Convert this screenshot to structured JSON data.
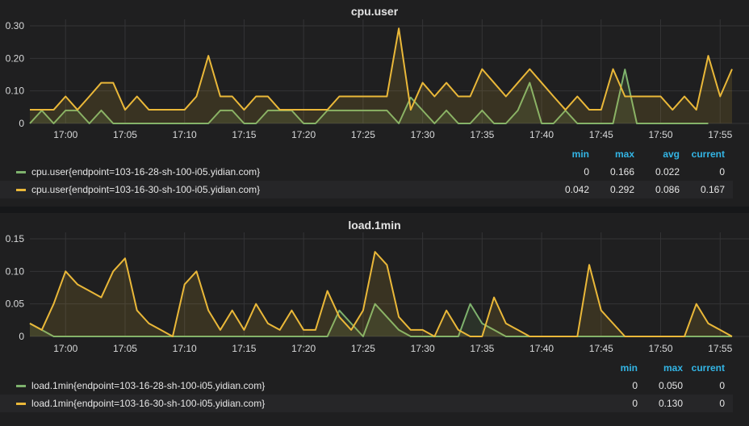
{
  "colors": {
    "green": "#7eb26d",
    "yellow": "#eab839",
    "grid": "#343436",
    "header": "#33b5e5"
  },
  "xticks": [
    "17:00",
    "17:05",
    "17:10",
    "17:15",
    "17:20",
    "17:25",
    "17:30",
    "17:35",
    "17:40",
    "17:45",
    "17:50",
    "17:55"
  ],
  "chart_data": [
    {
      "type": "line",
      "title": "cpu.user",
      "x_start_minute": "16:57",
      "x_step_minutes": 1,
      "yticks": [
        "0",
        "0.10",
        "0.20",
        "0.30"
      ],
      "ylim": [
        0,
        0.3
      ],
      "series": [
        {
          "name": "cpu.user{endpoint=103-16-28-sh-100-i05.yidian.com}",
          "color": "green",
          "values": [
            0,
            0.04,
            0,
            0.04,
            0.04,
            0,
            0.04,
            0,
            0,
            0,
            0,
            0,
            0,
            0,
            0,
            0,
            0.04,
            0.04,
            0,
            0,
            0.04,
            0.04,
            0.04,
            0,
            0,
            0.04,
            0.04,
            0.04,
            0.04,
            0.04,
            0.04,
            0,
            0.08,
            0.04,
            0,
            0.04,
            0,
            0,
            0.04,
            0,
            0,
            0.04,
            0.125,
            0,
            0,
            0.04,
            0,
            0,
            0,
            0,
            0.166,
            0,
            0,
            0,
            0,
            0,
            0,
            0
          ],
          "stats": {
            "min": "0",
            "max": "0.166",
            "avg": "0.022",
            "current": "0"
          }
        },
        {
          "name": "cpu.user{endpoint=103-16-30-sh-100-i05.yidian.com}",
          "color": "yellow",
          "values": [
            0.042,
            0.042,
            0.042,
            0.083,
            0.042,
            0.083,
            0.125,
            0.125,
            0.042,
            0.083,
            0.042,
            0.042,
            0.042,
            0.042,
            0.083,
            0.208,
            0.083,
            0.083,
            0.042,
            0.083,
            0.083,
            0.042,
            0.042,
            0.042,
            0.042,
            0.042,
            0.083,
            0.083,
            0.083,
            0.083,
            0.083,
            0.292,
            0.042,
            0.125,
            0.083,
            0.125,
            0.083,
            0.083,
            0.167,
            0.125,
            0.083,
            0.125,
            0.167,
            0.125,
            0.083,
            0.042,
            0.083,
            0.042,
            0.042,
            0.167,
            0.083,
            0.083,
            0.083,
            0.083,
            0.042,
            0.083,
            0.042,
            0.208,
            0.083,
            0.167
          ],
          "stats": {
            "min": "0.042",
            "max": "0.292",
            "avg": "0.086",
            "current": "0.167"
          }
        }
      ],
      "legend_headers": [
        "min",
        "max",
        "avg",
        "current"
      ]
    },
    {
      "type": "line",
      "title": "load.1min",
      "x_start_minute": "16:57",
      "x_step_minutes": 1,
      "yticks": [
        "0",
        "0.05",
        "0.10",
        "0.15"
      ],
      "ylim": [
        0,
        0.15
      ],
      "series": [
        {
          "name": "load.1min{endpoint=103-16-28-sh-100-i05.yidian.com}",
          "color": "green",
          "values": [
            0.02,
            0.01,
            0,
            0,
            0,
            0,
            0,
            0,
            0,
            0,
            0,
            0,
            0,
            0,
            0,
            0,
            0,
            0,
            0,
            0,
            0,
            0,
            0,
            0,
            0,
            0,
            0.04,
            0.02,
            0,
            0.05,
            0.03,
            0.01,
            0,
            0,
            0,
            0,
            0,
            0.05,
            0.02,
            0.01,
            0,
            0,
            0,
            0,
            0,
            0,
            0,
            0,
            0,
            0,
            0,
            0,
            0,
            0,
            0,
            0,
            0,
            0,
            0,
            0
          ],
          "stats": {
            "min": "0",
            "max": "0.050",
            "current": "0"
          }
        },
        {
          "name": "load.1min{endpoint=103-16-30-sh-100-i05.yidian.com}",
          "color": "yellow",
          "values": [
            0.02,
            0.01,
            0.05,
            0.1,
            0.08,
            0.07,
            0.06,
            0.1,
            0.12,
            0.04,
            0.02,
            0.01,
            0,
            0.08,
            0.1,
            0.04,
            0.01,
            0.04,
            0.01,
            0.05,
            0.02,
            0.01,
            0.04,
            0.01,
            0.01,
            0.07,
            0.03,
            0.01,
            0.04,
            0.13,
            0.11,
            0.03,
            0.01,
            0.01,
            0,
            0.04,
            0.01,
            0,
            0,
            0.06,
            0.02,
            0.01,
            0,
            0,
            0,
            0,
            0,
            0.11,
            0.04,
            0.02,
            0,
            0,
            0,
            0,
            0,
            0,
            0.05,
            0.02,
            0.01,
            0
          ],
          "stats": {
            "min": "0",
            "max": "0.130",
            "current": "0"
          }
        }
      ],
      "legend_headers": [
        "min",
        "max",
        "current"
      ]
    }
  ]
}
